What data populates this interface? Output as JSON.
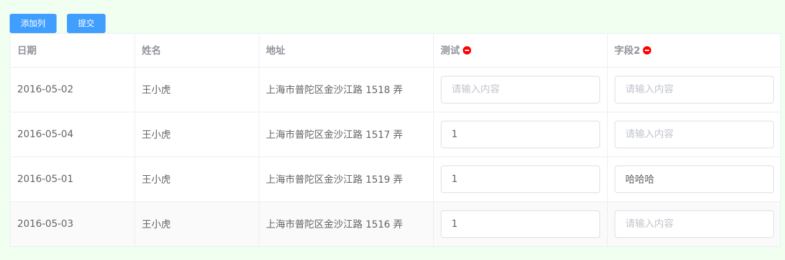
{
  "toolbar": {
    "add_column_label": "添加列",
    "submit_label": "提交"
  },
  "table": {
    "headers": {
      "date": "日期",
      "name": "姓名",
      "address": "地址",
      "test": "测试",
      "field2": "字段2"
    },
    "rows": [
      {
        "date": "2016-05-02",
        "name": "王小虎",
        "address": "上海市普陀区金沙江路 1518 弄",
        "test": "",
        "field2": ""
      },
      {
        "date": "2016-05-04",
        "name": "王小虎",
        "address": "上海市普陀区金沙江路 1517 弄",
        "test": "1",
        "field2": ""
      },
      {
        "date": "2016-05-01",
        "name": "王小虎",
        "address": "上海市普陀区金沙江路 1519 弄",
        "test": "1",
        "field2": "哈哈哈"
      },
      {
        "date": "2016-05-03",
        "name": "王小虎",
        "address": "上海市普陀区金沙江路 1516 弄",
        "test": "1",
        "field2": ""
      }
    ],
    "input_placeholder": "请输入内容",
    "remove_icon": "minus-circle-icon",
    "remove_icon_color": "#ff0000"
  },
  "colors": {
    "page_background": "#f0fff0",
    "primary": "#409eff",
    "striped_row": "#fafafa",
    "border": "#ebeef5"
  }
}
